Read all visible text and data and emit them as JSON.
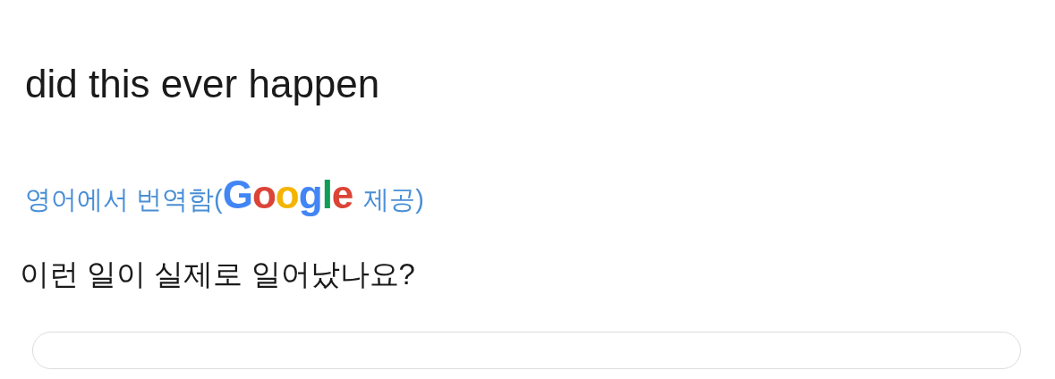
{
  "post": {
    "text": "did this ever happen"
  },
  "translation": {
    "label": "영어에서 번역함(",
    "provider": "Google",
    "suffix": "제공)",
    "text": "이런 일이 실제로 일어났나요?"
  }
}
